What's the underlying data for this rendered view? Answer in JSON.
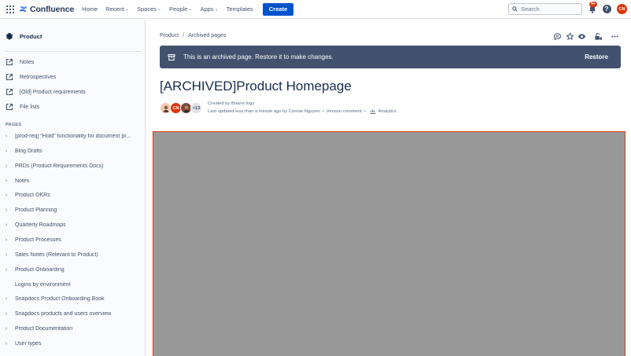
{
  "topnav": {
    "logo_text": "Confluence",
    "items": [
      {
        "label": "Home",
        "dropdown": false
      },
      {
        "label": "Recent",
        "dropdown": true
      },
      {
        "label": "Spaces",
        "dropdown": true
      },
      {
        "label": "People",
        "dropdown": true
      },
      {
        "label": "Apps",
        "dropdown": true
      },
      {
        "label": "Templates",
        "dropdown": false
      }
    ],
    "create_label": "Create",
    "search_placeholder": "Search",
    "notification_count": "9+",
    "user_initials": "CN"
  },
  "sidebar": {
    "space_name": "Product",
    "shortcuts": [
      {
        "label": "Notes",
        "icon": "external-link-icon"
      },
      {
        "label": "Retrospectives",
        "icon": "external-link-icon"
      },
      {
        "label": "[Old] Product requirements",
        "icon": "external-link-icon"
      },
      {
        "label": "File lists",
        "icon": "external-link-icon"
      }
    ],
    "pages_heading": "PAGES",
    "pages": [
      {
        "label": "[prod-req] \"Hold\" functionality for document pr...",
        "expandable": true
      },
      {
        "label": "Blog Drafts",
        "expandable": true
      },
      {
        "label": "PRDs (Product Requirements Docs)",
        "expandable": true
      },
      {
        "label": "Notes",
        "expandable": true
      },
      {
        "label": "Product OKRs",
        "expandable": true
      },
      {
        "label": "Product Planning",
        "expandable": true
      },
      {
        "label": "Quarterly Roadmaps",
        "expandable": true
      },
      {
        "label": "Product Processes",
        "expandable": true
      },
      {
        "label": "Sales Notes (Relevant to Product)",
        "expandable": true
      },
      {
        "label": "Product Onboarding",
        "expandable": true
      },
      {
        "label": "Logins by environment",
        "expandable": false
      },
      {
        "label": "Snapdocs Product Onboarding Book",
        "expandable": true
      },
      {
        "label": "Snapdocs products and users overview",
        "expandable": true
      },
      {
        "label": "Product Documentation",
        "expandable": true
      },
      {
        "label": "User types",
        "expandable": true
      }
    ]
  },
  "main": {
    "breadcrumb": [
      "Product",
      "Archived pages"
    ],
    "banner": {
      "message": "This is an archived page. Restore it to make changes.",
      "restore_label": "Restore"
    },
    "title": "[ARCHIVED]Product Homepage",
    "contributors_more": "+13",
    "created_by": "Created by Briana Ings",
    "last_updated": "Last updated less than a minute ago by Connie Nguyen",
    "version_comment": "Version comment",
    "analytics": "Analytics",
    "avatar_initials": "CN"
  },
  "colors": {
    "brand_blue": "#0052cc",
    "banner_bg": "#42526e",
    "content_placeholder": "#999999",
    "highlight_border": "#de350b"
  }
}
